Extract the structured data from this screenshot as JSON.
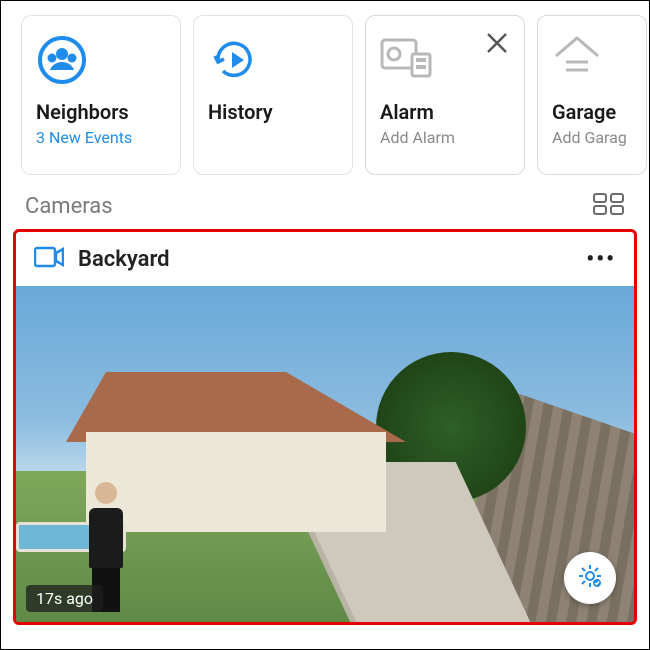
{
  "tiles": {
    "neighbors": {
      "label": "Neighbors",
      "sub": "3 New Events"
    },
    "history": {
      "label": "History"
    },
    "alarm": {
      "label": "Alarm",
      "sub": "Add Alarm"
    },
    "garage": {
      "label": "Garage",
      "sub": "Add Garag"
    }
  },
  "section": {
    "cameras_label": "Cameras"
  },
  "camera": {
    "name": "Backyard",
    "timestamp": "17s ago"
  }
}
